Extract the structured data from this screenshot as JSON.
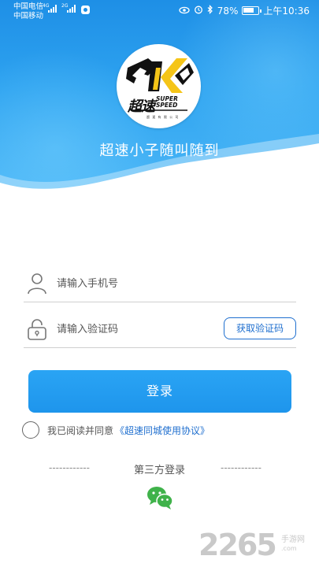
{
  "status_bar": {
    "carrier_1": "中国电信",
    "carrier_2": "中国移动",
    "net_1": "4G",
    "net_2": "2G",
    "battery_text": "78%",
    "battery_level": 0.78,
    "time": "上午10:36",
    "icons": [
      "eye-icon",
      "alarm-icon",
      "bluetooth-icon"
    ]
  },
  "header": {
    "logo_text_cn": "超速",
    "logo_text_en_1": "SUPER",
    "logo_text_en_2": "SPEED",
    "logo_subtitle": "超 速 有 限 公 司",
    "slogan": "超速小子随叫随到"
  },
  "form": {
    "phone_placeholder": "请输入手机号",
    "phone_value": "",
    "code_placeholder": "请输入验证码",
    "code_value": "",
    "get_code_label": "获取验证码",
    "login_label": "登录"
  },
  "agreement": {
    "prefix": "我已阅读并同意",
    "link": "《超速同城使用协议》",
    "checked": false
  },
  "third_party": {
    "dash_left": "------------",
    "label": "第三方登录",
    "dash_right": "------------",
    "providers": [
      "wechat-icon"
    ]
  },
  "watermark": {
    "number": "2265",
    "cn": "手游网",
    "url": ".com"
  },
  "colors": {
    "primary": "#1e95ec",
    "link": "#1f6fcf",
    "wechat": "#3fb24a"
  }
}
